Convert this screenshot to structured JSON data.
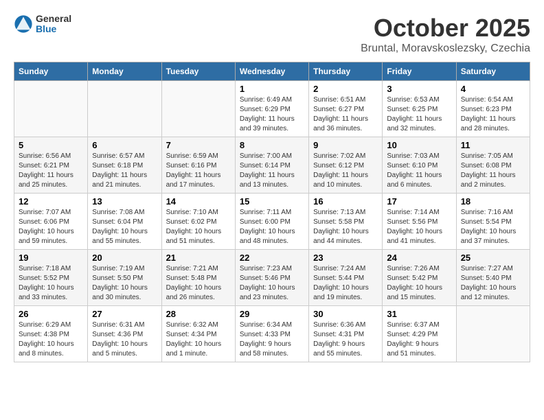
{
  "header": {
    "logo_general": "General",
    "logo_blue": "Blue",
    "month_title": "October 2025",
    "location": "Bruntal, Moravskoslezsky, Czechia"
  },
  "weekdays": [
    "Sunday",
    "Monday",
    "Tuesday",
    "Wednesday",
    "Thursday",
    "Friday",
    "Saturday"
  ],
  "weeks": [
    [
      {
        "day": "",
        "info": ""
      },
      {
        "day": "",
        "info": ""
      },
      {
        "day": "",
        "info": ""
      },
      {
        "day": "1",
        "info": "Sunrise: 6:49 AM\nSunset: 6:29 PM\nDaylight: 11 hours\nand 39 minutes."
      },
      {
        "day": "2",
        "info": "Sunrise: 6:51 AM\nSunset: 6:27 PM\nDaylight: 11 hours\nand 36 minutes."
      },
      {
        "day": "3",
        "info": "Sunrise: 6:53 AM\nSunset: 6:25 PM\nDaylight: 11 hours\nand 32 minutes."
      },
      {
        "day": "4",
        "info": "Sunrise: 6:54 AM\nSunset: 6:23 PM\nDaylight: 11 hours\nand 28 minutes."
      }
    ],
    [
      {
        "day": "5",
        "info": "Sunrise: 6:56 AM\nSunset: 6:21 PM\nDaylight: 11 hours\nand 25 minutes."
      },
      {
        "day": "6",
        "info": "Sunrise: 6:57 AM\nSunset: 6:18 PM\nDaylight: 11 hours\nand 21 minutes."
      },
      {
        "day": "7",
        "info": "Sunrise: 6:59 AM\nSunset: 6:16 PM\nDaylight: 11 hours\nand 17 minutes."
      },
      {
        "day": "8",
        "info": "Sunrise: 7:00 AM\nSunset: 6:14 PM\nDaylight: 11 hours\nand 13 minutes."
      },
      {
        "day": "9",
        "info": "Sunrise: 7:02 AM\nSunset: 6:12 PM\nDaylight: 11 hours\nand 10 minutes."
      },
      {
        "day": "10",
        "info": "Sunrise: 7:03 AM\nSunset: 6:10 PM\nDaylight: 11 hours\nand 6 minutes."
      },
      {
        "day": "11",
        "info": "Sunrise: 7:05 AM\nSunset: 6:08 PM\nDaylight: 11 hours\nand 2 minutes."
      }
    ],
    [
      {
        "day": "12",
        "info": "Sunrise: 7:07 AM\nSunset: 6:06 PM\nDaylight: 10 hours\nand 59 minutes."
      },
      {
        "day": "13",
        "info": "Sunrise: 7:08 AM\nSunset: 6:04 PM\nDaylight: 10 hours\nand 55 minutes."
      },
      {
        "day": "14",
        "info": "Sunrise: 7:10 AM\nSunset: 6:02 PM\nDaylight: 10 hours\nand 51 minutes."
      },
      {
        "day": "15",
        "info": "Sunrise: 7:11 AM\nSunset: 6:00 PM\nDaylight: 10 hours\nand 48 minutes."
      },
      {
        "day": "16",
        "info": "Sunrise: 7:13 AM\nSunset: 5:58 PM\nDaylight: 10 hours\nand 44 minutes."
      },
      {
        "day": "17",
        "info": "Sunrise: 7:14 AM\nSunset: 5:56 PM\nDaylight: 10 hours\nand 41 minutes."
      },
      {
        "day": "18",
        "info": "Sunrise: 7:16 AM\nSunset: 5:54 PM\nDaylight: 10 hours\nand 37 minutes."
      }
    ],
    [
      {
        "day": "19",
        "info": "Sunrise: 7:18 AM\nSunset: 5:52 PM\nDaylight: 10 hours\nand 33 minutes."
      },
      {
        "day": "20",
        "info": "Sunrise: 7:19 AM\nSunset: 5:50 PM\nDaylight: 10 hours\nand 30 minutes."
      },
      {
        "day": "21",
        "info": "Sunrise: 7:21 AM\nSunset: 5:48 PM\nDaylight: 10 hours\nand 26 minutes."
      },
      {
        "day": "22",
        "info": "Sunrise: 7:23 AM\nSunset: 5:46 PM\nDaylight: 10 hours\nand 23 minutes."
      },
      {
        "day": "23",
        "info": "Sunrise: 7:24 AM\nSunset: 5:44 PM\nDaylight: 10 hours\nand 19 minutes."
      },
      {
        "day": "24",
        "info": "Sunrise: 7:26 AM\nSunset: 5:42 PM\nDaylight: 10 hours\nand 15 minutes."
      },
      {
        "day": "25",
        "info": "Sunrise: 7:27 AM\nSunset: 5:40 PM\nDaylight: 10 hours\nand 12 minutes."
      }
    ],
    [
      {
        "day": "26",
        "info": "Sunrise: 6:29 AM\nSunset: 4:38 PM\nDaylight: 10 hours\nand 8 minutes."
      },
      {
        "day": "27",
        "info": "Sunrise: 6:31 AM\nSunset: 4:36 PM\nDaylight: 10 hours\nand 5 minutes."
      },
      {
        "day": "28",
        "info": "Sunrise: 6:32 AM\nSunset: 4:34 PM\nDaylight: 10 hours\nand 1 minute."
      },
      {
        "day": "29",
        "info": "Sunrise: 6:34 AM\nSunset: 4:33 PM\nDaylight: 9 hours\nand 58 minutes."
      },
      {
        "day": "30",
        "info": "Sunrise: 6:36 AM\nSunset: 4:31 PM\nDaylight: 9 hours\nand 55 minutes."
      },
      {
        "day": "31",
        "info": "Sunrise: 6:37 AM\nSunset: 4:29 PM\nDaylight: 9 hours\nand 51 minutes."
      },
      {
        "day": "",
        "info": ""
      }
    ]
  ]
}
